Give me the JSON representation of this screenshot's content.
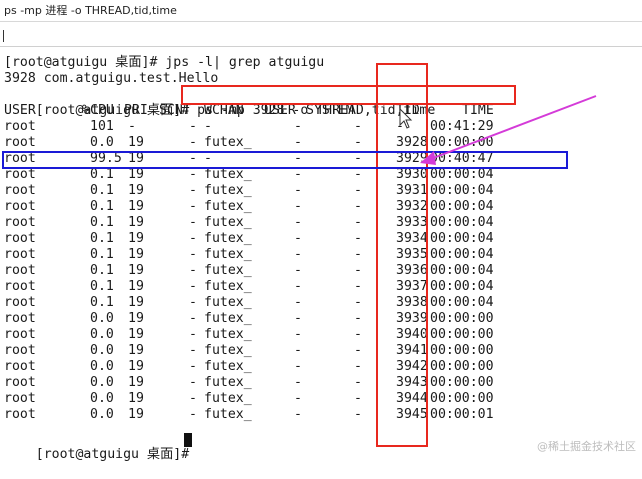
{
  "window": {
    "title": "ps -mp 进程 -o THREAD,tid,time"
  },
  "terminal": {
    "cmd1": "[root@atguigu 桌面]# jps -l| grep atguigu",
    "out1": "3928 com.atguigu.test.Hello",
    "cmd2_prompt": "[root@atguigu 桌面]# ",
    "cmd2_text": "ps -mp 3928 -o THREAD,tid,time",
    "headers": {
      "user": "USER",
      "cpu": "%CPU",
      "pri": "PRI",
      "scnt": "SCNT",
      "wchan": "WCHAN",
      "user2": "USER",
      "system": "SYSTEM",
      "tid": "TID",
      "time": "TIME"
    },
    "rows": [
      {
        "user": "root",
        "cpu": "101",
        "pri": "-",
        "scnt": "-",
        "wchan": "-",
        "user2": "-",
        "system": "-",
        "tid": "-",
        "time": "00:41:29"
      },
      {
        "user": "root",
        "cpu": "0.0",
        "pri": "19",
        "scnt": "-",
        "wchan": "futex_",
        "user2": "-",
        "system": "-",
        "tid": "3928",
        "time": "00:00:00"
      },
      {
        "user": "root",
        "cpu": "99.5",
        "pri": "19",
        "scnt": "-",
        "wchan": "-",
        "user2": "-",
        "system": "-",
        "tid": "3929",
        "time": "00:40:47"
      },
      {
        "user": "root",
        "cpu": "0.1",
        "pri": "19",
        "scnt": "-",
        "wchan": "futex_",
        "user2": "-",
        "system": "-",
        "tid": "3930",
        "time": "00:00:04"
      },
      {
        "user": "root",
        "cpu": "0.1",
        "pri": "19",
        "scnt": "-",
        "wchan": "futex_",
        "user2": "-",
        "system": "-",
        "tid": "3931",
        "time": "00:00:04"
      },
      {
        "user": "root",
        "cpu": "0.1",
        "pri": "19",
        "scnt": "-",
        "wchan": "futex_",
        "user2": "-",
        "system": "-",
        "tid": "3932",
        "time": "00:00:04"
      },
      {
        "user": "root",
        "cpu": "0.1",
        "pri": "19",
        "scnt": "-",
        "wchan": "futex_",
        "user2": "-",
        "system": "-",
        "tid": "3933",
        "time": "00:00:04"
      },
      {
        "user": "root",
        "cpu": "0.1",
        "pri": "19",
        "scnt": "-",
        "wchan": "futex_",
        "user2": "-",
        "system": "-",
        "tid": "3934",
        "time": "00:00:04"
      },
      {
        "user": "root",
        "cpu": "0.1",
        "pri": "19",
        "scnt": "-",
        "wchan": "futex_",
        "user2": "-",
        "system": "-",
        "tid": "3935",
        "time": "00:00:04"
      },
      {
        "user": "root",
        "cpu": "0.1",
        "pri": "19",
        "scnt": "-",
        "wchan": "futex_",
        "user2": "-",
        "system": "-",
        "tid": "3936",
        "time": "00:00:04"
      },
      {
        "user": "root",
        "cpu": "0.1",
        "pri": "19",
        "scnt": "-",
        "wchan": "futex_",
        "user2": "-",
        "system": "-",
        "tid": "3937",
        "time": "00:00:04"
      },
      {
        "user": "root",
        "cpu": "0.1",
        "pri": "19",
        "scnt": "-",
        "wchan": "futex_",
        "user2": "-",
        "system": "-",
        "tid": "3938",
        "time": "00:00:04"
      },
      {
        "user": "root",
        "cpu": "0.0",
        "pri": "19",
        "scnt": "-",
        "wchan": "futex_",
        "user2": "-",
        "system": "-",
        "tid": "3939",
        "time": "00:00:00"
      },
      {
        "user": "root",
        "cpu": "0.0",
        "pri": "19",
        "scnt": "-",
        "wchan": "futex_",
        "user2": "-",
        "system": "-",
        "tid": "3940",
        "time": "00:00:00"
      },
      {
        "user": "root",
        "cpu": "0.0",
        "pri": "19",
        "scnt": "-",
        "wchan": "futex_",
        "user2": "-",
        "system": "-",
        "tid": "3941",
        "time": "00:00:00"
      },
      {
        "user": "root",
        "cpu": "0.0",
        "pri": "19",
        "scnt": "-",
        "wchan": "futex_",
        "user2": "-",
        "system": "-",
        "tid": "3942",
        "time": "00:00:00"
      },
      {
        "user": "root",
        "cpu": "0.0",
        "pri": "19",
        "scnt": "-",
        "wchan": "futex_",
        "user2": "-",
        "system": "-",
        "tid": "3943",
        "time": "00:00:00"
      },
      {
        "user": "root",
        "cpu": "0.0",
        "pri": "19",
        "scnt": "-",
        "wchan": "futex_",
        "user2": "-",
        "system": "-",
        "tid": "3944",
        "time": "00:00:00"
      },
      {
        "user": "root",
        "cpu": "0.0",
        "pri": "19",
        "scnt": "-",
        "wchan": "futex_",
        "user2": "-",
        "system": "-",
        "tid": "3945",
        "time": "00:00:01"
      }
    ],
    "last_prompt": "[root@atguigu 桌面]# "
  },
  "watermark": "@稀土掘金技术社区",
  "colors": {
    "annotation_red": "#e8281e",
    "annotation_blue": "#1a1ad6",
    "arrow_magenta": "#d43bd8"
  }
}
